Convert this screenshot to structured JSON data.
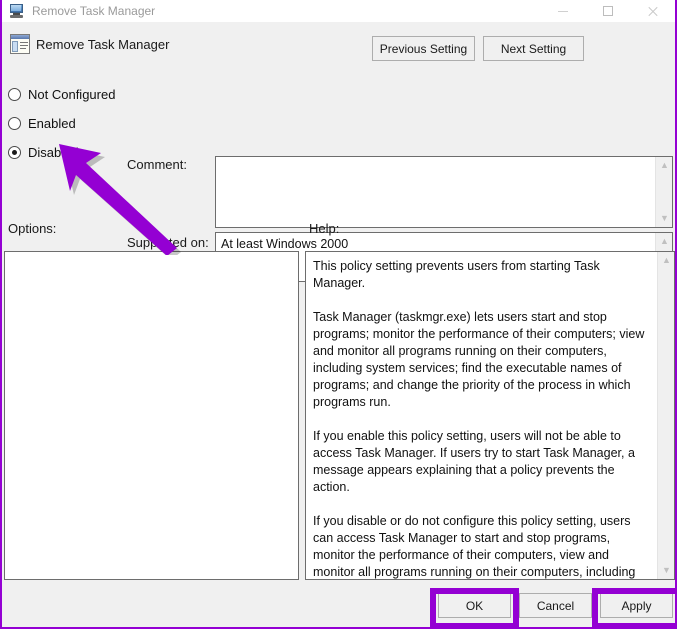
{
  "window": {
    "title": "Remove Task Manager",
    "title_icon": "computer-monitor-icon",
    "controls": {
      "minimize": "minimize-icon",
      "maximize": "maximize-icon",
      "close": "close-icon"
    }
  },
  "header": {
    "icon": "policy-setting-icon",
    "title": "Remove Task Manager",
    "previous_label": "Previous Setting",
    "next_label": "Next Setting"
  },
  "state_options": [
    {
      "label": "Not Configured",
      "selected": false
    },
    {
      "label": "Enabled",
      "selected": false
    },
    {
      "label": "Disabled",
      "selected": true
    }
  ],
  "fields": {
    "comment_label": "Comment:",
    "comment_value": "",
    "supported_label": "Supported on:",
    "supported_value": "At least Windows 2000"
  },
  "panels": {
    "options_label": "Options:",
    "options_content": "",
    "help_label": "Help:",
    "help_paragraphs": [
      "This policy setting prevents users from starting Task Manager.",
      "Task Manager (taskmgr.exe) lets users start and stop programs; monitor the performance of their computers; view and monitor all programs running on their computers, including system services; find the executable names of programs; and change the priority of the process in which programs run.",
      "If you enable this policy setting, users will not be able to access Task Manager. If users try to start Task Manager, a message appears explaining that a policy prevents the action.",
      "If you disable or do not configure this policy setting, users can access Task Manager to  start and stop programs, monitor the performance of their computers, view and monitor all programs running on their computers, including system services, find the executable names of programs, and change the priority of the process in which programs run."
    ]
  },
  "footer": {
    "ok_label": "OK",
    "cancel_label": "Cancel",
    "apply_label": "Apply"
  },
  "annotations": {
    "highlight_color": "#9400d3",
    "arrow_color": "#9400d3",
    "arrow_target": "Disabled",
    "highlighted_buttons": [
      "OK",
      "Apply"
    ]
  }
}
